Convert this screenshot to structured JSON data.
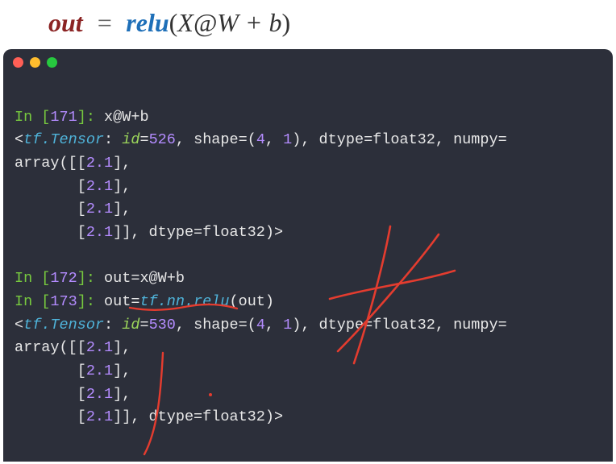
{
  "formula": {
    "out": "out",
    "eq": "=",
    "relu": "relu",
    "lpar": "(",
    "X": "X",
    "at": "@",
    "W": "W",
    "plus": "+",
    "b": "b",
    "rpar": ")"
  },
  "terminal": {
    "in171_label": "In [",
    "in171_num": "171",
    "in171_close": "]: ",
    "in171_code": "x@W+b",
    "out171_l1a": "<",
    "out171_l1b": "tf.Tensor",
    "out171_l1c": ": ",
    "out171_l1d": "id",
    "out171_l1e": "=",
    "out171_l1f": "526",
    "out171_l1g": ", shape=(",
    "out171_l1h": "4",
    "out171_l1i": ", ",
    "out171_l1j": "1",
    "out171_l1k": "), dtype=float32, numpy=",
    "out171_l2": "array([[",
    "out171_val": "2.1",
    "out171_l2b": "],",
    "out171_l3a": "       [",
    "out171_l3b": "],",
    "out171_l4a": "       [",
    "out171_l4b": "],",
    "out171_l5a": "       [",
    "out171_l5b": "]], dtype=float32)>",
    "in172_num": "172",
    "in172_code": "out=x@W+b",
    "in173_num": "173",
    "in173_code_a": "out=",
    "in173_code_b": "tf.nn.relu",
    "in173_code_c": "(out)",
    "out173_l1f": "530",
    "blank": ""
  }
}
